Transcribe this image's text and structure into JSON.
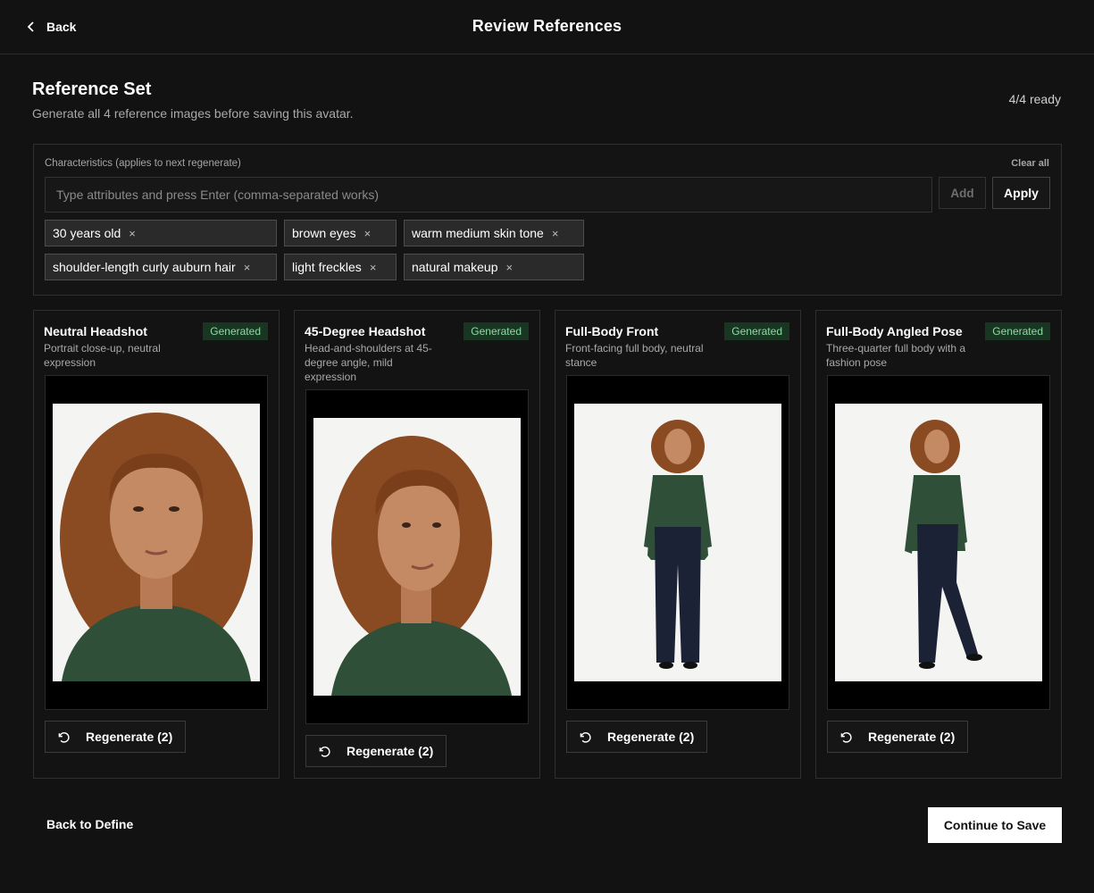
{
  "topbar": {
    "back_label": "Back",
    "title": "Review References"
  },
  "header": {
    "title": "Reference Set",
    "subtitle": "Generate all 4 reference images before saving this avatar.",
    "ready_count": "4/4 ready"
  },
  "characteristics": {
    "label": "Characteristics (applies to next regenerate)",
    "clear_all": "Clear all",
    "input_placeholder": "Type attributes and press Enter (comma-separated works)",
    "input_value": "",
    "add_label": "Add",
    "apply_label": "Apply",
    "chips": [
      "30 years old",
      "brown eyes",
      "warm medium skin tone",
      "shoulder-length curly auburn hair",
      "light freckles",
      "natural makeup"
    ],
    "remove_glyph": "×"
  },
  "cards": [
    {
      "title": "Neutral Headshot",
      "status": "Generated",
      "description": "Portrait close-up, neutral expression",
      "regenerate_label": "Regenerate (2)"
    },
    {
      "title": "45-Degree Headshot",
      "status": "Generated",
      "description": "Head-and-shoulders at 45-degree angle, mild expression",
      "regenerate_label": "Regenerate (2)"
    },
    {
      "title": "Full-Body Front",
      "status": "Generated",
      "description": "Front-facing full body, neutral stance",
      "regenerate_label": "Regenerate (2)"
    },
    {
      "title": "Full-Body Angled Pose",
      "status": "Generated",
      "description": "Three-quarter full body with a fashion pose",
      "regenerate_label": "Regenerate (2)"
    }
  ],
  "footer": {
    "back_label": "Back to Define",
    "continue_label": "Continue to Save"
  },
  "colors": {
    "background": "#121212",
    "badge_bg": "#183622",
    "badge_text": "#8fdba4",
    "shirt": "#2f4f38",
    "hair": "#8a4a22",
    "pants": "#1c2236"
  },
  "icons": {
    "back": "chevron-left-icon",
    "remove": "close-icon",
    "regenerate": "refresh-icon"
  }
}
